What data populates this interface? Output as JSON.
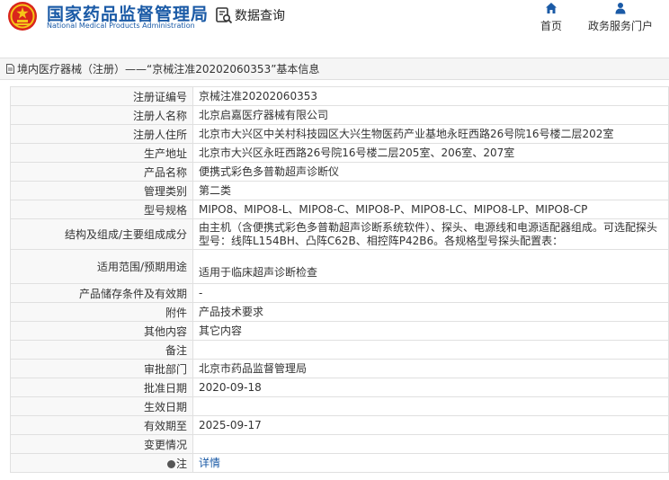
{
  "header": {
    "site_name_cn": "国家药品监督管理局",
    "site_name_en": "National Medical Products Administration",
    "db_query_label": "数据查询",
    "nav": [
      {
        "label": "首页",
        "icon": "home-icon"
      },
      {
        "label": "政务服务门户",
        "icon": "user-icon"
      }
    ]
  },
  "breadcrumb": {
    "text": "境内医疗器械（注册）——“京械注准20202060353”基本信息"
  },
  "record": {
    "rows": [
      {
        "label": "注册证编号",
        "value": "京械注准20202060353"
      },
      {
        "label": "注册人名称",
        "value": "北京启嘉医疗器械有限公司"
      },
      {
        "label": "注册人住所",
        "value": "北京市大兴区中关村科技园区大兴生物医药产业基地永旺西路26号院16号楼二层202室"
      },
      {
        "label": "生产地址",
        "value": "北京市大兴区永旺西路26号院16号楼二层205室、206室、207室"
      },
      {
        "label": "产品名称",
        "value": "便携式彩色多普勒超声诊断仪"
      },
      {
        "label": "管理类别",
        "value": "第二类"
      },
      {
        "label": "型号规格",
        "value": "MIPO8、MIPO8-L、MIPO8-C、MIPO8-P、MIPO8-LC、MIPO8-LP、MIPO8-CP"
      },
      {
        "label": "结构及组成/主要组成成分",
        "value": "由主机（含便携式彩色多普勒超声诊断系统软件）、探头、电源线和电源适配器组成。可选配探头型号：线阵L154BH、凸阵C62B、相控阵P42B6。各规格型号探头配置表："
      },
      {
        "label": "适用范围/预期用途",
        "value": "适用于临床超声诊断检查"
      },
      {
        "label": "产品储存条件及有效期",
        "value": "-"
      },
      {
        "label": "附件",
        "value": "产品技术要求"
      },
      {
        "label": "其他内容",
        "value": "其它内容"
      },
      {
        "label": "备注",
        "value": ""
      },
      {
        "label": "审批部门",
        "value": "北京市药品监督管理局"
      },
      {
        "label": "批准日期",
        "value": "2020-09-18"
      },
      {
        "label": "生效日期",
        "value": ""
      },
      {
        "label": "有效期至",
        "value": "2025-09-17"
      },
      {
        "label": "变更情况",
        "value": ""
      }
    ],
    "note_label": "注",
    "note_link": "详情"
  },
  "colors": {
    "brand_blue": "#1a5aa6",
    "label_bg": "#f8f8f8",
    "border": "#e0e0e0"
  }
}
